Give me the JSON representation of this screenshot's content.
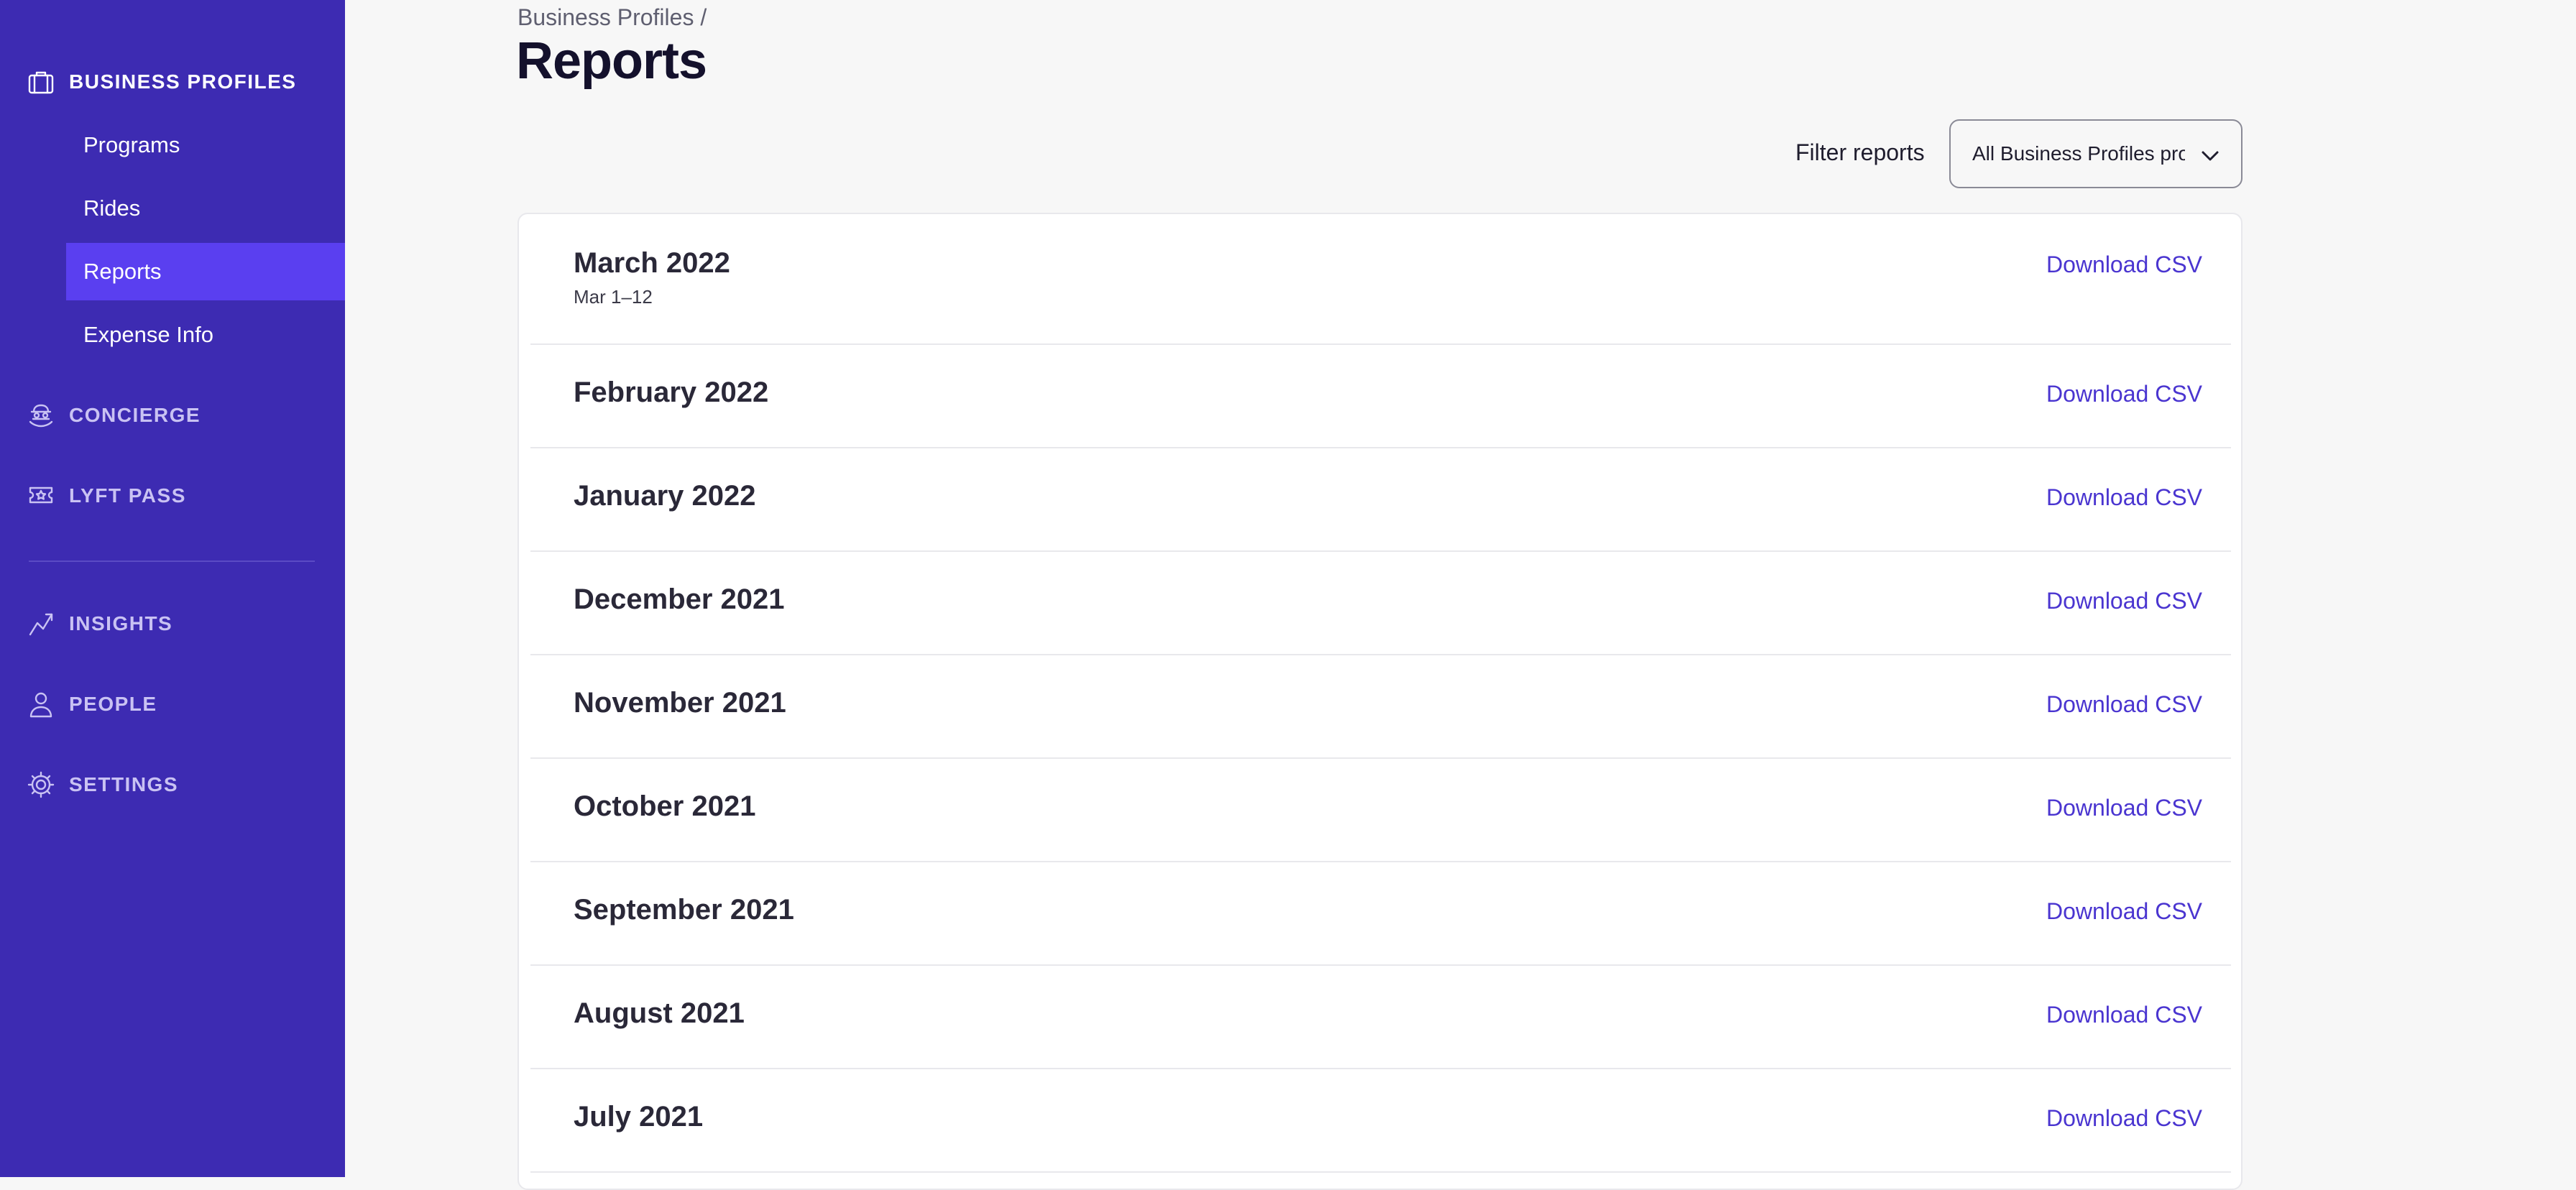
{
  "sidebar": {
    "business_profiles": {
      "label": "BUSINESS PROFILES",
      "icon": "briefcase-icon",
      "items": [
        {
          "label": "Programs"
        },
        {
          "label": "Rides"
        },
        {
          "label": "Reports",
          "selected": true
        },
        {
          "label": "Expense Info"
        }
      ]
    },
    "concierge": {
      "label": "CONCIERGE",
      "icon": "concierge-icon"
    },
    "lyft_pass": {
      "label": "LYFT PASS",
      "icon": "pass-icon"
    },
    "insights": {
      "label": "INSIGHTS",
      "icon": "chart-trend-icon"
    },
    "people": {
      "label": "PEOPLE",
      "icon": "person-icon"
    },
    "settings": {
      "label": "SETTINGS",
      "icon": "gear-icon"
    }
  },
  "colors": {
    "sidebar_bg": "#3d2bb2",
    "sidebar_selected": "#5a3ff0",
    "link": "#4a35d0"
  },
  "header": {
    "breadcrumb": "Business Profiles /",
    "title": "Reports"
  },
  "filter": {
    "label": "Filter reports",
    "selected_value": "All Business Profiles programs"
  },
  "reports": [
    {
      "title": "March 2022",
      "subtitle": "Mar 1–12",
      "action": "Download CSV"
    },
    {
      "title": "February 2022",
      "action": "Download CSV"
    },
    {
      "title": "January 2022",
      "action": "Download CSV"
    },
    {
      "title": "December 2021",
      "action": "Download CSV"
    },
    {
      "title": "November 2021",
      "action": "Download CSV"
    },
    {
      "title": "October 2021",
      "action": "Download CSV"
    },
    {
      "title": "September 2021",
      "action": "Download CSV"
    },
    {
      "title": "August 2021",
      "action": "Download CSV"
    },
    {
      "title": "July 2021",
      "action": "Download CSV"
    }
  ]
}
